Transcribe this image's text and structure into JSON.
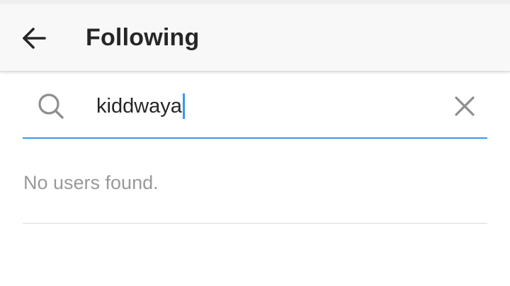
{
  "header": {
    "title": "Following",
    "back_icon": "arrow-left-icon"
  },
  "search": {
    "icon": "search-icon",
    "value": "kiddwaya",
    "clear_icon": "close-icon",
    "accent_color": "#3897f0"
  },
  "results": {
    "empty_message": "No users found."
  }
}
